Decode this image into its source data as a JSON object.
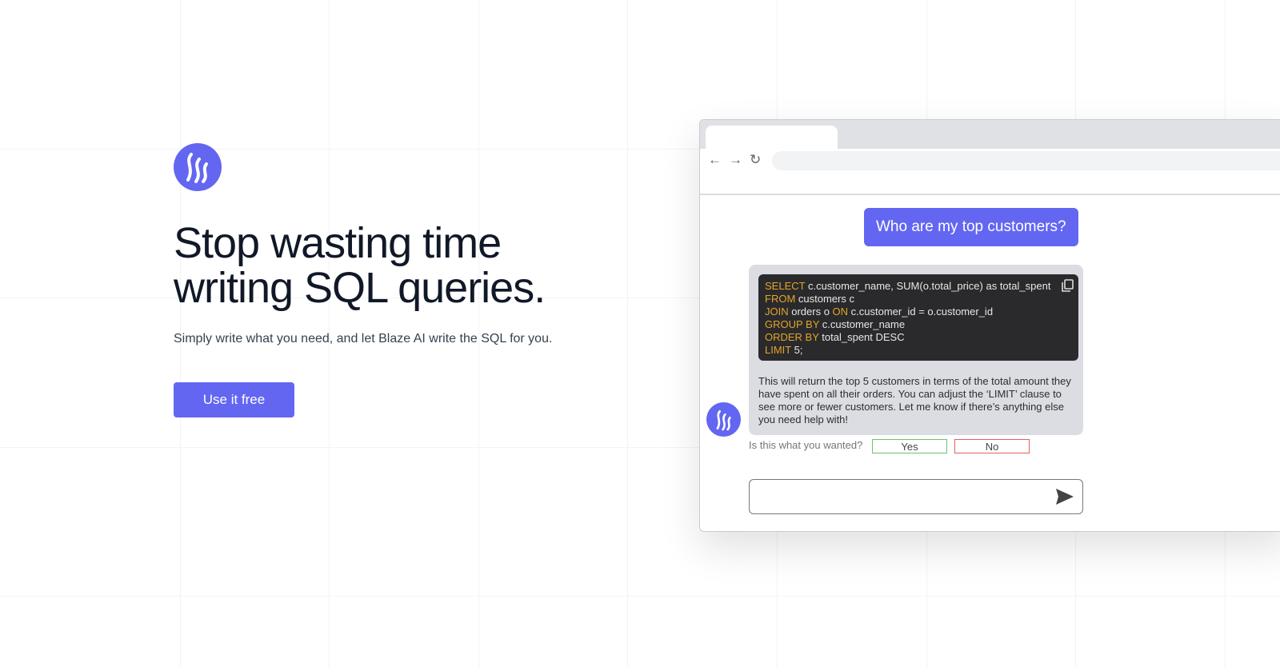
{
  "hero": {
    "title_line1": "Stop wasting time",
    "title_line2": "writing SQL queries.",
    "subtitle": "Simply write what you need, and let Blaze AI write the SQL for you.",
    "cta_label": "Use it free"
  },
  "brand_color": "#6366f1",
  "browser": {
    "nav": {
      "back": "←",
      "forward": "→",
      "reload": "↻"
    },
    "chat": {
      "question": "Who are my top customers?",
      "code": [
        {
          "kw": "SELECT",
          "rest": " c.customer_name, SUM(o.total_price) as total_spent"
        },
        {
          "kw": "FROM",
          "rest": " customers c"
        },
        {
          "kw": "JOIN",
          "rest": " orders o ",
          "kw2": "ON",
          "rest2": " c.customer_id = o.customer_id"
        },
        {
          "kw": "GROUP BY",
          "rest": " c.customer_name"
        },
        {
          "kw": "ORDER BY",
          "rest": " total_spent DESC"
        },
        {
          "kw": "LIMIT",
          "rest": " 5;"
        }
      ],
      "answer": "This will return the top 5 customers in terms of the total amount they have spent on all their orders. You can adjust the ‘LIMIT’ clause to see more or fewer customers. Let me know if there’s anything else you need help with!",
      "feedback_prompt": "Is this what you wanted?",
      "yes_label": "Yes",
      "no_label": "No",
      "input_placeholder": ""
    }
  }
}
